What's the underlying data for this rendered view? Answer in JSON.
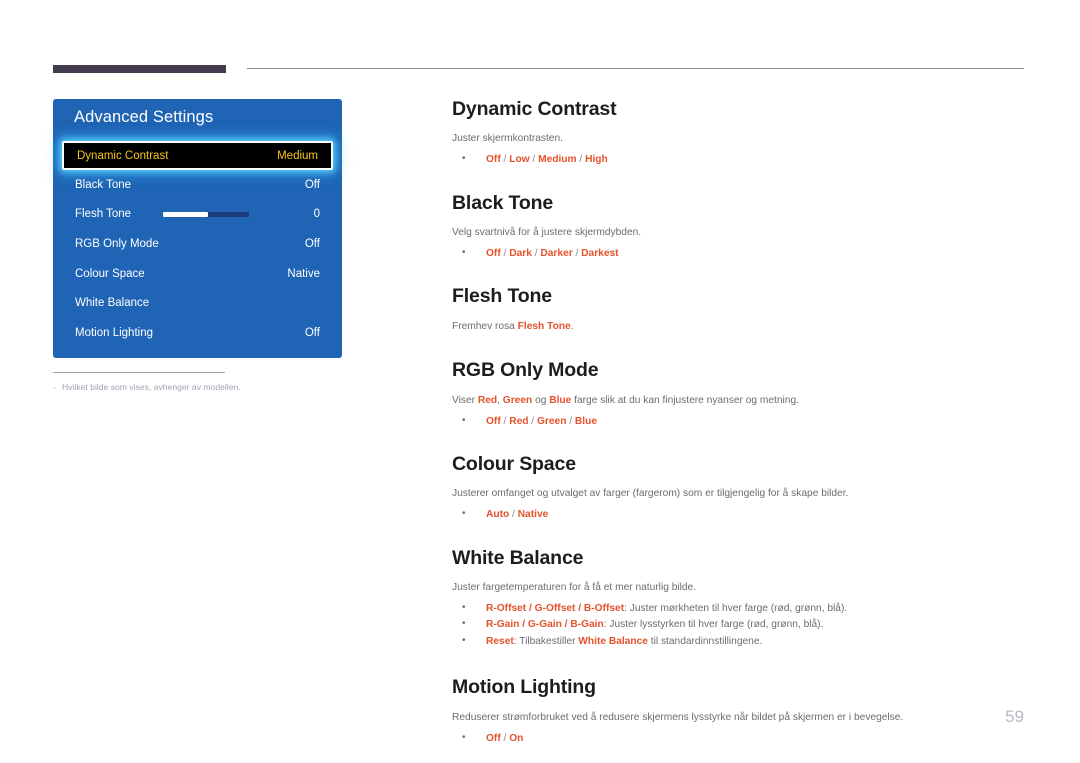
{
  "header": {
    "bar_color": "#413b4d",
    "rule_color": "#8c8a93"
  },
  "osd": {
    "title": "Advanced Settings",
    "panel_color": "#1f64b5",
    "highlight_text_color": "#f5c518",
    "rows": [
      {
        "label": "Dynamic Contrast",
        "value": "Medium",
        "selected": true
      },
      {
        "label": "Black Tone",
        "value": "Off",
        "selected": false
      },
      {
        "label": "Flesh Tone",
        "value": "0",
        "selected": false,
        "slider": 52
      },
      {
        "label": "RGB Only Mode",
        "value": "Off",
        "selected": false
      },
      {
        "label": "Colour Space",
        "value": "Native",
        "selected": false
      },
      {
        "label": "White Balance",
        "value": "",
        "selected": false
      },
      {
        "label": "Motion Lighting",
        "value": "Off",
        "selected": false
      }
    ]
  },
  "footnote": {
    "dash": "‐",
    "text": "Hvilket bilde som vises, avhenger av modellen."
  },
  "sections": {
    "dynamic_contrast": {
      "title": "Dynamic Contrast",
      "desc": "Juster skjermkontrasten.",
      "bullet1": {
        "a": "Off",
        "s1": " / ",
        "b": "Low",
        "s2": " / ",
        "c": "Medium",
        "s3": " / ",
        "d": "High"
      }
    },
    "black_tone": {
      "title": "Black Tone",
      "desc": "Velg svartnivå for å justere skjermdybden.",
      "bullet1": {
        "a": "Off",
        "s1": " / ",
        "b": "Dark",
        "s2": " / ",
        "c": "Darker",
        "s3": " / ",
        "d": "Darkest"
      }
    },
    "flesh_tone": {
      "title": "Flesh Tone",
      "desc_pre": "Fremhev rosa ",
      "desc_hl": "Flesh Tone",
      "desc_post": "."
    },
    "rgb_only_mode": {
      "title": "RGB Only Mode",
      "desc_pre": "Viser ",
      "desc_hl1": "Red",
      "desc_mid1": ", ",
      "desc_hl2": "Green",
      "desc_mid2": " og ",
      "desc_hl3": "Blue",
      "desc_post": " farge slik at du kan finjustere nyanser og metning.",
      "bullet1": {
        "a": "Off",
        "s1": " / ",
        "b": "Red",
        "s2": " / ",
        "c": "Green",
        "s3": " / ",
        "d": "Blue"
      }
    },
    "colour_space": {
      "title": "Colour Space",
      "desc": "Justerer omfanget og utvalget av farger (fargerom) som er tilgjengelig for å skape bilder.",
      "bullet1": {
        "a": "Auto",
        "s1": " / ",
        "b": "Native"
      }
    },
    "white_balance": {
      "title": "White Balance",
      "desc": "Juster fargetemperaturen for å få et mer naturlig bilde.",
      "bullet1": {
        "hl": "R-Offset / G-Offset / B-Offset",
        "rest": ": Juster mørkheten til hver farge (rød, grønn, blå)."
      },
      "bullet2": {
        "hl": "R-Gain / G-Gain / B-Gain",
        "rest": ": Juster lysstyrken til hver farge (rød, grønn, blå)."
      },
      "bullet3": {
        "hl": "Reset",
        "mid": ": Tilbakestiller ",
        "hl2": "White Balance",
        "rest": " til standardinnstillingene."
      }
    },
    "motion_lighting": {
      "title": "Motion Lighting",
      "desc": "Reduserer strømforbruket ved å redusere skjermens lysstyrke når bildet på skjermen er i bevegelse.",
      "bullet1": {
        "a": "Off",
        "s1": " / ",
        "b": "On"
      }
    }
  },
  "page_number": "59",
  "accent_color": "#e4532c",
  "body_text_color": "#6e6b70"
}
